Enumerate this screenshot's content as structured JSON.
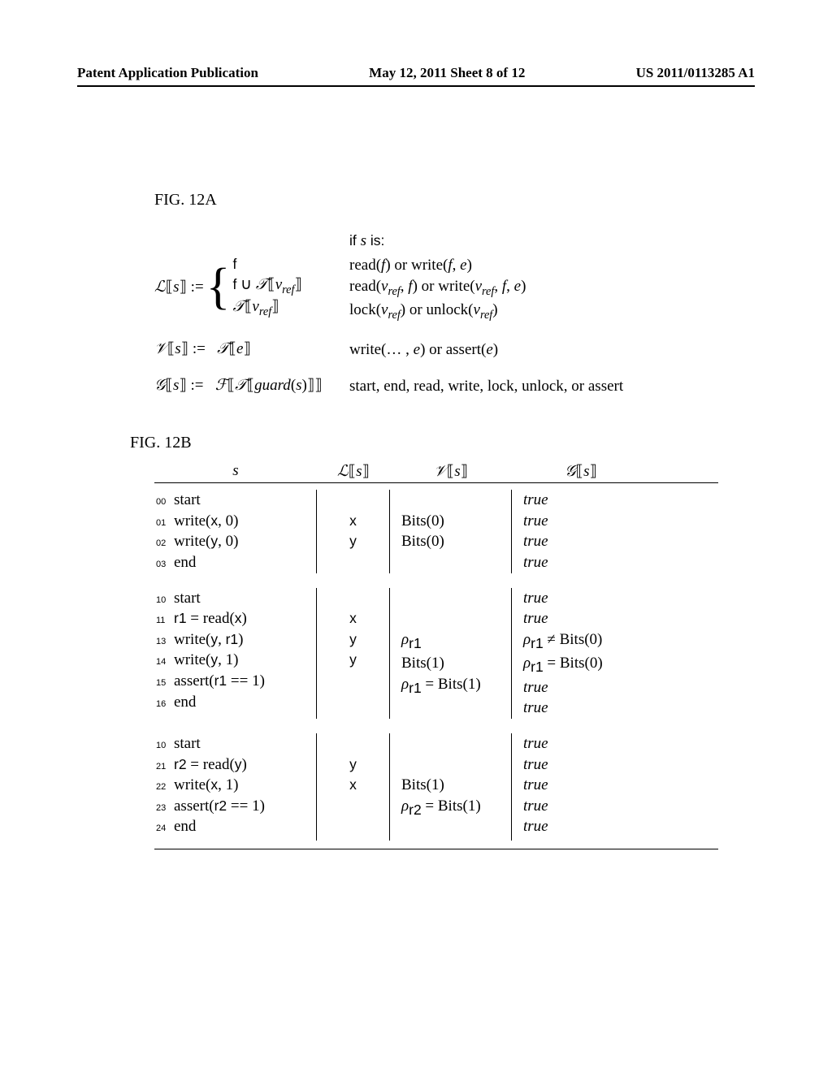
{
  "header": {
    "left": "Patent Application Publication",
    "center": "May 12, 2011  Sheet 8 of 12",
    "right": "US 2011/0113285 A1"
  },
  "figA": {
    "label": "FIG. 12A",
    "ifSIs": "if s is:",
    "Ls": "ℒ⟦s⟧ :=",
    "brace1": "f",
    "brace2": "f ∪ 𝒯⟦v_ref⟧",
    "brace3": "𝒯⟦v_ref⟧",
    "Ls_rhs1": "read(f) or write(f, e)",
    "Ls_rhs2": "read(v_ref, f) or write(v_ref, f, e)",
    "Ls_rhs3": "lock(v_ref) or unlock(v_ref)",
    "Vs": "𝒱⟦s⟧ :=   𝒯⟦e⟧",
    "Vs_rhs": "write(… , e) or assert(e)",
    "Gs": "𝒢⟦s⟧ :=   ℱ⟦𝒯⟦guard(s)⟧⟧",
    "Gs_rhs": "start, end, read, write, lock, unlock, or assert"
  },
  "figB": {
    "label": "FIG. 12B",
    "header": {
      "s": "s",
      "L": "ℒ⟦s⟧",
      "V": "𝒱⟦s⟧",
      "G": "𝒢⟦s⟧"
    },
    "rows": [
      {
        "n": "00",
        "s": "start",
        "L": "",
        "V": "",
        "G": "true"
      },
      {
        "n": "01",
        "s": "write(x, 0)",
        "L": "x",
        "V": "Bits(0)",
        "G": "true"
      },
      {
        "n": "02",
        "s": "write(y, 0)",
        "L": "y",
        "V": "Bits(0)",
        "G": "true"
      },
      {
        "n": "03",
        "s": "end",
        "L": "",
        "V": "",
        "G": "true"
      },
      {
        "n": "10",
        "s": "start",
        "L": "",
        "V": "",
        "G": "true"
      },
      {
        "n": "11",
        "s": "r1 = read(x)",
        "L": "x",
        "V": "",
        "G": "true"
      },
      {
        "n": "13",
        "s": "write(y, r1)",
        "L": "y",
        "V": "ρ_r1",
        "G": "ρ_r1 ≠ Bits(0)"
      },
      {
        "n": "14",
        "s": "write(y, 1)",
        "L": "y",
        "V": "Bits(1)",
        "G": "ρ_r1 = Bits(0)"
      },
      {
        "n": "15",
        "s": "assert(r1 == 1)",
        "L": "",
        "V": "ρ_r1 = Bits(1)",
        "G": "true"
      },
      {
        "n": "16",
        "s": "end",
        "L": "",
        "V": "",
        "G": "true"
      },
      {
        "n": "10",
        "s": "start",
        "L": "",
        "V": "",
        "G": "true"
      },
      {
        "n": "21",
        "s": "r2 = read(y)",
        "L": "y",
        "V": "",
        "G": "true"
      },
      {
        "n": "22",
        "s": "write(x, 1)",
        "L": "x",
        "V": "Bits(1)",
        "G": "true"
      },
      {
        "n": "23",
        "s": "assert(r2 == 1)",
        "L": "",
        "V": "ρ_r2 = Bits(1)",
        "G": "true"
      },
      {
        "n": "24",
        "s": "end",
        "L": "",
        "V": "",
        "G": "true"
      }
    ]
  }
}
